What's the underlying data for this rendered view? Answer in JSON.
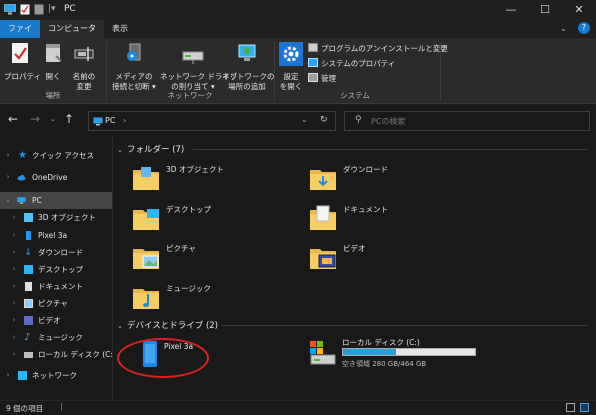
{
  "window": {
    "title": "PC",
    "minimize": "—",
    "maximize": "☐",
    "close": "✕"
  },
  "ribbon_tabs": [
    "ファイル",
    "コンピューター",
    "表示"
  ],
  "ribbon": {
    "location_group": {
      "label": "場所",
      "buttons": [
        "プロパティ",
        "開く",
        "名前の\n変更"
      ]
    },
    "network_group": {
      "label": "ネットワーク",
      "buttons": [
        "メディアの\n接続と切断 ▾",
        "ネットワーク ドライブ\nの割り当て ▾",
        "ネットワークの\n場所の追加"
      ]
    },
    "system_group": {
      "label": "システム",
      "open_settings": "設定\nを開く",
      "uninstall": "プログラムのアンインストールと変更",
      "system_properties": "システムのプロパティ",
      "manage": "管理"
    }
  },
  "address": {
    "path": "PC",
    "search_placeholder": "PCの検索"
  },
  "nav_pane": [
    {
      "label": "クイック アクセス",
      "icon": "star-icon"
    },
    {
      "label": "OneDrive",
      "icon": "cloud-icon"
    },
    {
      "label": "PC",
      "icon": "pc-icon"
    },
    {
      "label": "3D オブジェクト",
      "icon": "3d-icon"
    },
    {
      "label": "Pixel 3a",
      "icon": "phone-icon"
    },
    {
      "label": "ダウンロード",
      "icon": "download-icon"
    },
    {
      "label": "デスクトップ",
      "icon": "desktop-icon"
    },
    {
      "label": "ドキュメント",
      "icon": "document-icon"
    },
    {
      "label": "ピクチャ",
      "icon": "picture-icon"
    },
    {
      "label": "ビデオ",
      "icon": "video-icon"
    },
    {
      "label": "ミュージック",
      "icon": "music-icon"
    },
    {
      "label": "ローカル ディスク (C:)",
      "icon": "disk-icon"
    },
    {
      "label": "ネットワーク",
      "icon": "network-icon"
    }
  ],
  "folders_group": {
    "header": "フォルダー (7)",
    "items": [
      "3D オブジェクト",
      "ダウンロード",
      "デスクトップ",
      "ドキュメント",
      "ピクチャ",
      "ビデオ",
      "ミュージック"
    ]
  },
  "devices_group": {
    "header": "デバイスとドライブ (2)",
    "phone": "Pixel 3a",
    "disk": {
      "name": "ローカル ディスク (C:)",
      "free_text": "空き領域 280 GB/464 GB",
      "used_fraction": 0.4
    }
  },
  "status": {
    "item_count": "9 個の項目"
  },
  "colors": {
    "accent": "#1979ca",
    "folder": "#f0c45a",
    "annotation": "#e02020"
  }
}
